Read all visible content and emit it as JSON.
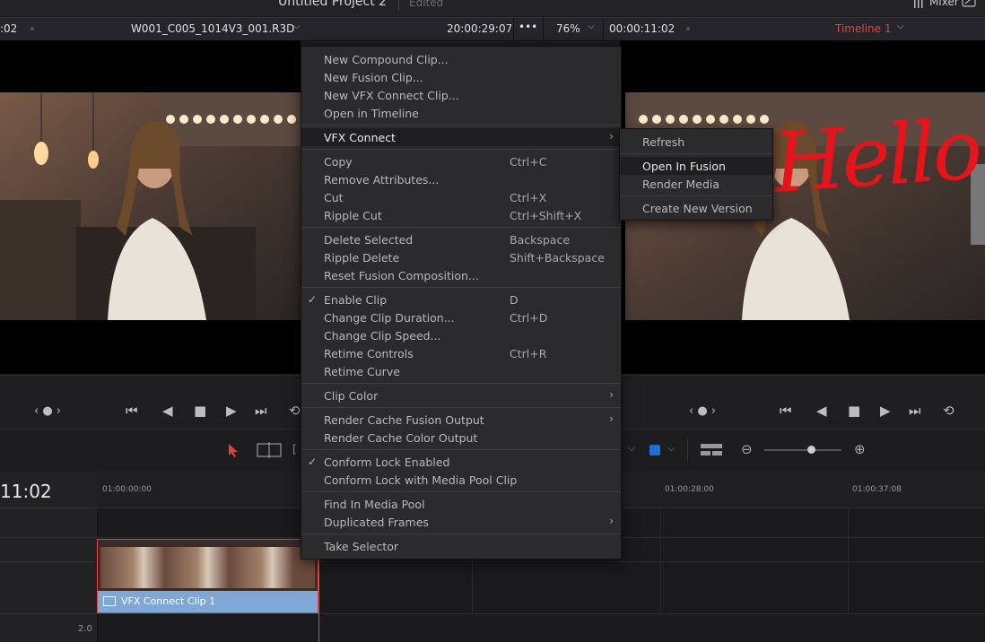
{
  "app": {
    "project_title": "Untitled Project 2",
    "project_status": "Edited",
    "mixer_label": "Mixer"
  },
  "viewer_header": {
    "left_timecode": ":02",
    "clip_name": "W001_C005_1014V3_001.R3D",
    "source_timecode": "20:00:29:07",
    "more": "•••",
    "zoom": "76%",
    "record_timecode": "00:00:11:02",
    "timeline_name": "Timeline 1"
  },
  "colors": {
    "accent_red": "#e0443a",
    "clip_blue": "#7fa8d6",
    "menu_bg": "#2b2b2e"
  },
  "timeline": {
    "current_timecode": "11:02",
    "ruler_labels": [
      "01:00:00:00",
      "01:00:28:00",
      "01:00:37:08"
    ],
    "clip_label": "VFX Connect Clip 1",
    "track_level": "2.0"
  },
  "context_menu": {
    "groups": [
      [
        {
          "label": "New Compound Clip...",
          "shortcut": "",
          "checked": false,
          "submenu": false,
          "highlight": false
        },
        {
          "label": "New Fusion Clip...",
          "shortcut": "",
          "checked": false,
          "submenu": false,
          "highlight": false
        },
        {
          "label": "New VFX Connect Clip...",
          "shortcut": "",
          "checked": false,
          "submenu": false,
          "highlight": false
        },
        {
          "label": "Open in Timeline",
          "shortcut": "",
          "checked": false,
          "submenu": false,
          "highlight": false
        }
      ],
      [
        {
          "label": "VFX Connect",
          "shortcut": "",
          "checked": false,
          "submenu": true,
          "highlight": true
        }
      ],
      [
        {
          "label": "Copy",
          "shortcut": "Ctrl+C",
          "checked": false,
          "submenu": false,
          "highlight": false
        },
        {
          "label": "Remove Attributes...",
          "shortcut": "",
          "checked": false,
          "submenu": false,
          "highlight": false
        },
        {
          "label": "Cut",
          "shortcut": "Ctrl+X",
          "checked": false,
          "submenu": false,
          "highlight": false
        },
        {
          "label": "Ripple Cut",
          "shortcut": "Ctrl+Shift+X",
          "checked": false,
          "submenu": false,
          "highlight": false
        }
      ],
      [
        {
          "label": "Delete Selected",
          "shortcut": "Backspace",
          "checked": false,
          "submenu": false,
          "highlight": false
        },
        {
          "label": "Ripple Delete",
          "shortcut": "Shift+Backspace",
          "checked": false,
          "submenu": false,
          "highlight": false
        },
        {
          "label": "Reset Fusion Composition...",
          "shortcut": "",
          "checked": false,
          "submenu": false,
          "highlight": false
        }
      ],
      [
        {
          "label": "Enable Clip",
          "shortcut": "D",
          "checked": true,
          "submenu": false,
          "highlight": false
        },
        {
          "label": "Change Clip Duration...",
          "shortcut": "Ctrl+D",
          "checked": false,
          "submenu": false,
          "highlight": false
        },
        {
          "label": "Change Clip Speed...",
          "shortcut": "",
          "checked": false,
          "submenu": false,
          "highlight": false
        },
        {
          "label": "Retime Controls",
          "shortcut": "Ctrl+R",
          "checked": false,
          "submenu": false,
          "highlight": false
        },
        {
          "label": "Retime Curve",
          "shortcut": "",
          "checked": false,
          "submenu": false,
          "highlight": false
        }
      ],
      [
        {
          "label": "Clip Color",
          "shortcut": "",
          "checked": false,
          "submenu": true,
          "highlight": false
        }
      ],
      [
        {
          "label": "Render Cache Fusion Output",
          "shortcut": "",
          "checked": false,
          "submenu": true,
          "highlight": false
        },
        {
          "label": "Render Cache Color Output",
          "shortcut": "",
          "checked": false,
          "submenu": false,
          "highlight": false
        }
      ],
      [
        {
          "label": "Conform Lock Enabled",
          "shortcut": "",
          "checked": true,
          "submenu": false,
          "highlight": false
        },
        {
          "label": "Conform Lock with Media Pool Clip",
          "shortcut": "",
          "checked": false,
          "submenu": false,
          "highlight": false
        }
      ],
      [
        {
          "label": "Find In Media Pool",
          "shortcut": "",
          "checked": false,
          "submenu": false,
          "highlight": false
        },
        {
          "label": "Duplicated Frames",
          "shortcut": "",
          "checked": false,
          "submenu": true,
          "highlight": false
        }
      ],
      [
        {
          "label": "Take Selector",
          "shortcut": "",
          "checked": false,
          "submenu": false,
          "highlight": false
        }
      ]
    ]
  },
  "submenu": {
    "groups": [
      [
        {
          "label": "Refresh",
          "highlight": false
        }
      ],
      [
        {
          "label": "Open In Fusion",
          "highlight": true
        },
        {
          "label": "Render Media",
          "highlight": false
        }
      ],
      [
        {
          "label": "Create New Version",
          "highlight": false
        }
      ]
    ]
  },
  "overlay_text": "Hello"
}
